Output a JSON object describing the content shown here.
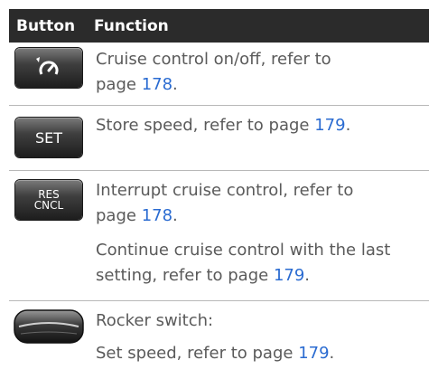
{
  "header": {
    "button": "Button",
    "function": "Function"
  },
  "rows": [
    {
      "icon": "cruise-control-icon",
      "paragraphs": [
        [
          {
            "t": "Cruise control on/off, refer to"
          },
          {
            "t": "page "
          },
          {
            "t": "178",
            "link": true
          },
          {
            "t": "."
          }
        ]
      ]
    },
    {
      "icon": "set-button",
      "button_label": "SET",
      "paragraphs": [
        [
          {
            "t": "Store speed, refer to page "
          },
          {
            "t": "179",
            "link": true
          },
          {
            "t": "."
          }
        ]
      ]
    },
    {
      "icon": "res-cncl-button",
      "button_label_top": "RES",
      "button_label_bottom": "CNCL",
      "paragraphs": [
        [
          {
            "t": "Interrupt cruise control, refer to"
          },
          {
            "t": "page "
          },
          {
            "t": "178",
            "link": true
          },
          {
            "t": "."
          }
        ],
        [
          {
            "t": "Continue cruise control with the last"
          },
          {
            "t": "setting, refer to page "
          },
          {
            "t": "179",
            "link": true
          },
          {
            "t": "."
          }
        ]
      ]
    },
    {
      "icon": "rocker-switch-icon",
      "paragraphs": [
        [
          {
            "t": "Rocker switch:"
          }
        ],
        [
          {
            "t": "Set speed, refer to page "
          },
          {
            "t": "179",
            "link": true
          },
          {
            "t": "."
          }
        ]
      ]
    }
  ],
  "colors": {
    "header_bg": "#2b2b2b",
    "text": "#5a5a5a",
    "link": "#2a6bd1"
  }
}
